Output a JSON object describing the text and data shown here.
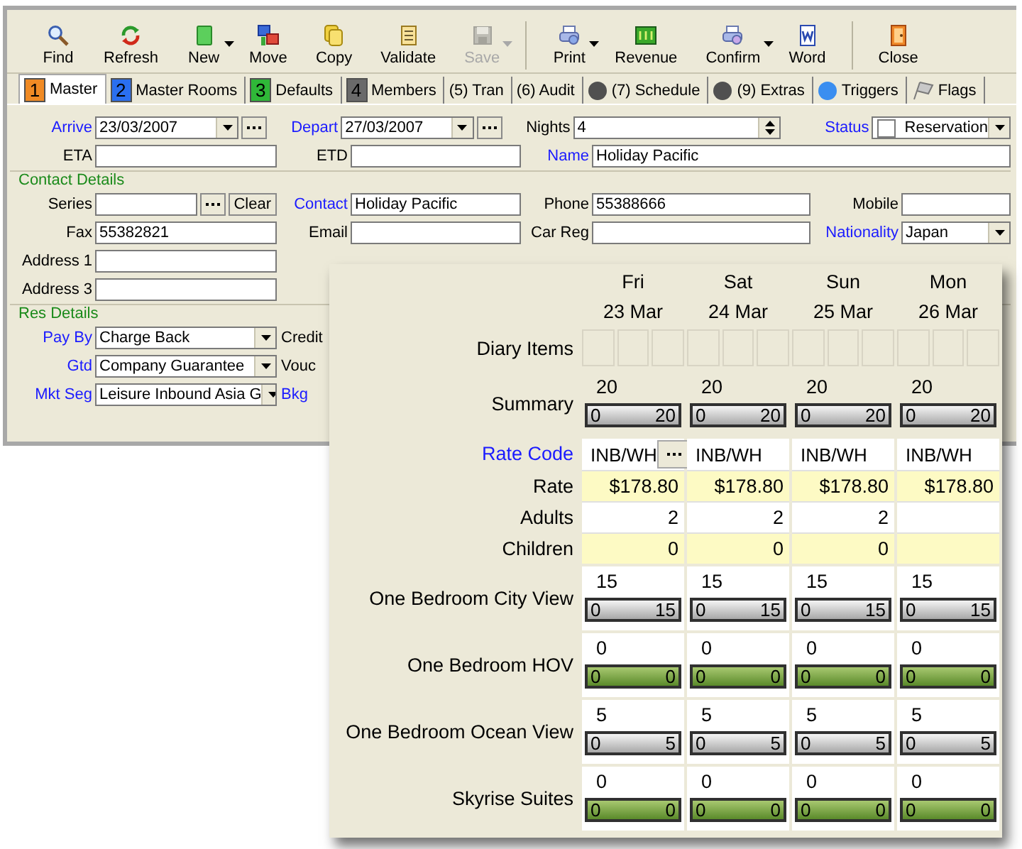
{
  "toolbar": [
    {
      "label": "Find",
      "dropdown": false,
      "disabled": false,
      "separator_before": false
    },
    {
      "label": "Refresh",
      "dropdown": false,
      "disabled": false,
      "separator_before": false
    },
    {
      "label": "New",
      "dropdown": true,
      "disabled": false,
      "separator_before": false
    },
    {
      "label": "Move",
      "dropdown": false,
      "disabled": false,
      "separator_before": false
    },
    {
      "label": "Copy",
      "dropdown": false,
      "disabled": false,
      "separator_before": false
    },
    {
      "label": "Validate",
      "dropdown": false,
      "disabled": false,
      "separator_before": false
    },
    {
      "label": "Save",
      "dropdown": true,
      "disabled": true,
      "separator_before": false
    },
    {
      "label": "Print",
      "dropdown": true,
      "disabled": false,
      "separator_before": true
    },
    {
      "label": "Revenue",
      "dropdown": false,
      "disabled": false,
      "separator_before": false
    },
    {
      "label": "Confirm",
      "dropdown": true,
      "disabled": false,
      "separator_before": false
    },
    {
      "label": "Word",
      "dropdown": false,
      "disabled": false,
      "separator_before": false
    },
    {
      "label": "Close",
      "dropdown": false,
      "disabled": false,
      "separator_before": true
    }
  ],
  "tabs": [
    {
      "label": "Master",
      "badge": "1",
      "color": "#f08a24",
      "kind": "badge",
      "selected": true
    },
    {
      "label": "Master Rooms",
      "badge": "2",
      "color": "#2a6ff0",
      "kind": "badge",
      "selected": false
    },
    {
      "label": "Defaults",
      "badge": "3",
      "color": "#2fb838",
      "kind": "badge",
      "selected": false
    },
    {
      "label": "Members",
      "badge": "4",
      "color": "#6a6a6a",
      "kind": "badge",
      "selected": false
    },
    {
      "label": "(5) Tran",
      "kind": "plain",
      "selected": false
    },
    {
      "label": "(6) Audit",
      "kind": "plain",
      "selected": false
    },
    {
      "label": "(7) Schedule",
      "kind": "ball",
      "color": "#505050",
      "selected": false
    },
    {
      "label": "(9) Extras",
      "kind": "ball",
      "color": "#505050",
      "selected": false
    },
    {
      "label": "Triggers",
      "kind": "ball",
      "color": "#3a8ef0",
      "selected": false
    },
    {
      "label": "Flags",
      "kind": "flag",
      "selected": false
    }
  ],
  "form_sections": [
    {
      "rows": [
        [
          {
            "label": "Arrive",
            "link": true,
            "kind": "date",
            "value": "23/03/2007"
          },
          {
            "label": "Depart",
            "link": true,
            "kind": "date",
            "value": "27/03/2007"
          },
          {
            "label": "Nights",
            "link": false,
            "kind": "spin",
            "value": "4"
          },
          {
            "label": "Status",
            "link": true,
            "kind": "status",
            "value": "Reservation",
            "checked": false
          }
        ],
        [
          {
            "label": "ETA",
            "link": false,
            "kind": "text"
          },
          {
            "label": "ETD",
            "link": false,
            "kind": "text"
          },
          {
            "label": "Name",
            "link": true,
            "kind": "wide",
            "value": "Holiday Pacific"
          }
        ]
      ]
    },
    {
      "title": "Contact Details",
      "rows": [
        [
          {
            "label": "Series",
            "link": false,
            "kind": "series",
            "button": "Clear"
          },
          {
            "label": "Contact",
            "link": true,
            "kind": "text",
            "value": "Holiday Pacific"
          },
          {
            "label": "Phone",
            "link": false,
            "kind": "text",
            "value": "55388666"
          },
          {
            "label": "Mobile",
            "link": false,
            "kind": "text"
          }
        ],
        [
          {
            "label": "Fax",
            "link": false,
            "kind": "text",
            "value": "55382821"
          },
          {
            "label": "Email",
            "link": false,
            "kind": "text"
          },
          {
            "label": "Car Reg",
            "link": false,
            "kind": "text"
          },
          {
            "label": "Nationality",
            "link": true,
            "kind": "combo",
            "value": "Japan"
          }
        ],
        [
          {
            "label": "Address 1",
            "link": false,
            "kind": "text"
          }
        ],
        [
          {
            "label": "Address 3",
            "link": false,
            "kind": "text"
          }
        ]
      ]
    },
    {
      "title": "Res Details",
      "rows": [
        [
          {
            "label": "Pay By",
            "link": true,
            "kind": "combo",
            "value": "Charge Back"
          },
          {
            "label": "Credit",
            "link": false,
            "kind": "label"
          }
        ],
        [
          {
            "label": "Gtd",
            "link": true,
            "kind": "combo",
            "value": "Company Guarantee"
          },
          {
            "label": "Vouc",
            "link": false,
            "kind": "label"
          }
        ],
        [
          {
            "label": "Mkt Seg",
            "link": true,
            "kind": "combo",
            "value": "Leisure Inbound Asia G"
          },
          {
            "label": "Bkg",
            "link": true,
            "kind": "label"
          }
        ]
      ]
    }
  ],
  "availability": {
    "days": [
      {
        "day": "Fri",
        "date": "23 Mar"
      },
      {
        "day": "Sat",
        "date": "24 Mar"
      },
      {
        "day": "Sun",
        "date": "25 Mar"
      },
      {
        "day": "Mon",
        "date": "26 Mar"
      }
    ],
    "rows": [
      {
        "kind": "diary",
        "label": "Diary Items",
        "link": false
      },
      {
        "kind": "meter",
        "label": "Summary",
        "link": false,
        "cells": [
          {
            "count": "20",
            "min": "0",
            "max": "20",
            "available": true
          },
          {
            "count": "20",
            "min": "0",
            "max": "20",
            "available": true
          },
          {
            "count": "20",
            "min": "0",
            "max": "20",
            "available": true
          },
          {
            "count": "20",
            "min": "0",
            "max": "20",
            "available": true
          }
        ]
      },
      {
        "kind": "ratecode",
        "label": "Rate Code",
        "link": true,
        "cells": [
          {
            "value": "INB/WH",
            "picker": true
          },
          {
            "value": "INB/WH",
            "picker": false
          },
          {
            "value": "INB/WH",
            "picker": false
          },
          {
            "value": "INB/WH",
            "picker": false
          }
        ]
      },
      {
        "kind": "value",
        "label": "Rate",
        "link": false,
        "highlight": true,
        "cells": [
          {
            "value": "$178.80"
          },
          {
            "value": "$178.80"
          },
          {
            "value": "$178.80"
          },
          {
            "value": "$178.80"
          }
        ]
      },
      {
        "kind": "value",
        "label": "Adults",
        "link": false,
        "highlight": false,
        "cells": [
          {
            "value": "2"
          },
          {
            "value": "2"
          },
          {
            "value": "2"
          },
          {}
        ]
      },
      {
        "kind": "value",
        "label": "Children",
        "link": false,
        "highlight": true,
        "cells": [
          {
            "value": "0"
          },
          {
            "value": "0"
          },
          {
            "value": "0"
          },
          {}
        ]
      },
      {
        "kind": "meter",
        "label": "One Bedroom City View",
        "link": false,
        "cells": [
          {
            "count": "15",
            "min": "0",
            "max": "15",
            "available": true
          },
          {
            "count": "15",
            "min": "0",
            "max": "15",
            "available": true
          },
          {
            "count": "15",
            "min": "0",
            "max": "15",
            "available": true
          },
          {
            "count": "15",
            "min": "0",
            "max": "15",
            "available": true
          }
        ]
      },
      {
        "kind": "meter",
        "label": "One Bedroom HOV",
        "link": false,
        "cells": [
          {
            "count": "0",
            "min": "0",
            "max": "0",
            "available": false
          },
          {
            "count": "0",
            "min": "0",
            "max": "0",
            "available": false
          },
          {
            "count": "0",
            "min": "0",
            "max": "0",
            "available": false
          },
          {
            "count": "0",
            "min": "0",
            "max": "0",
            "available": false
          }
        ]
      },
      {
        "kind": "meter",
        "label": "One Bedroom Ocean View",
        "link": false,
        "cells": [
          {
            "count": "5",
            "min": "0",
            "max": "5",
            "available": true
          },
          {
            "count": "5",
            "min": "0",
            "max": "5",
            "available": true
          },
          {
            "count": "5",
            "min": "0",
            "max": "5",
            "available": true
          },
          {
            "count": "5",
            "min": "0",
            "max": "5",
            "available": true
          }
        ]
      },
      {
        "kind": "meter",
        "label": "Skyrise Suites",
        "link": false,
        "cells": [
          {
            "count": "0",
            "min": "0",
            "max": "0",
            "available": false
          },
          {
            "count": "0",
            "min": "0",
            "max": "0",
            "available": false
          },
          {
            "count": "0",
            "min": "0",
            "max": "0",
            "available": false
          },
          {
            "count": "0",
            "min": "0",
            "max": "0",
            "available": false
          }
        ]
      }
    ]
  }
}
